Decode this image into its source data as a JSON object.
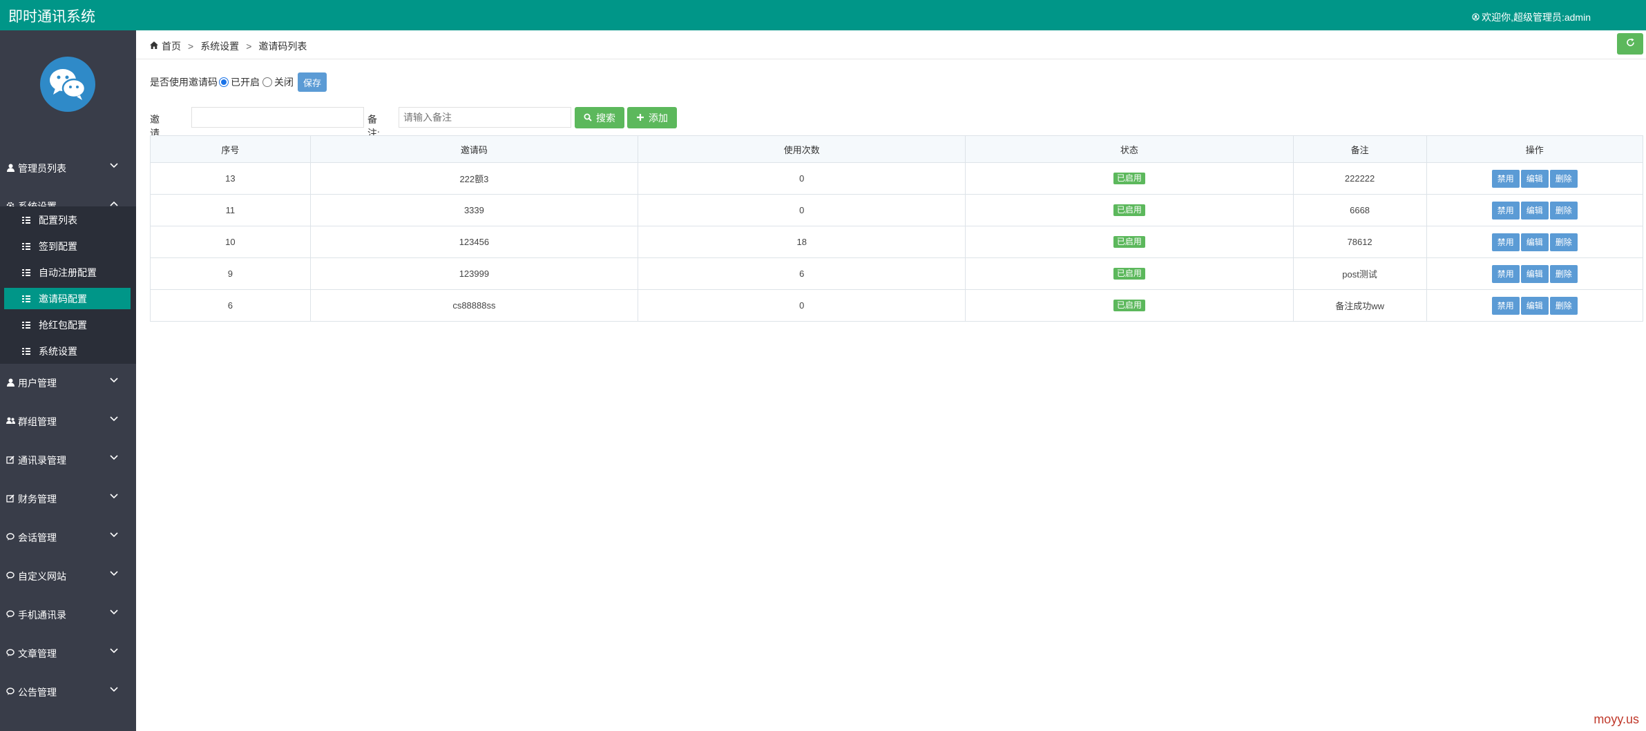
{
  "header": {
    "app_title": "即时通讯系统",
    "welcome": "欢迎你,超级管理员:admin",
    "user_icon": "user-circle-icon"
  },
  "sidebar": {
    "logo_icon": "wechat-logo-icon",
    "items": [
      {
        "label": "管理员列表",
        "icon": "user-icon"
      },
      {
        "label": "系统设置",
        "icon": "gear-icon"
      },
      {
        "label": "用户管理",
        "icon": "user-icon"
      },
      {
        "label": "群组管理",
        "icon": "users-icon"
      },
      {
        "label": "通讯录管理",
        "icon": "edit-icon"
      },
      {
        "label": "财务管理",
        "icon": "edit-icon"
      },
      {
        "label": "会话管理",
        "icon": "chat-icon"
      },
      {
        "label": "自定义网站",
        "icon": "chat-icon"
      },
      {
        "label": "手机通讯录",
        "icon": "chat-icon"
      },
      {
        "label": "文章管理",
        "icon": "chat-icon"
      },
      {
        "label": "公告管理",
        "icon": "chat-icon"
      }
    ],
    "sub_items": [
      {
        "label": "配置列表"
      },
      {
        "label": "签到配置"
      },
      {
        "label": "自动注册配置"
      },
      {
        "label": "邀请码配置"
      },
      {
        "label": "抢红包配置"
      },
      {
        "label": "系统设置"
      }
    ],
    "active_sub": "邀请码配置",
    "accent_color": "#009688"
  },
  "breadcrumb": {
    "home": "首页",
    "sep": ">",
    "level1": "系统设置",
    "level2": "邀请码列表"
  },
  "toggle": {
    "label": "是否使用邀请码",
    "on_label": "已开启",
    "off_label": "关闭",
    "selected": "已开启",
    "save_label": "保存"
  },
  "search": {
    "code_label": "邀请码:",
    "code_value": "",
    "remark_label": "备注:",
    "remark_placeholder": "请输入备注",
    "search_label": "搜索",
    "add_label": "添加"
  },
  "table": {
    "columns": [
      "序号",
      "邀请码",
      "使用次数",
      "状态",
      "备注",
      "操作"
    ],
    "rows": [
      {
        "id": "13",
        "code": "222额3",
        "uses": "0",
        "status": "已启用",
        "remark": "222222"
      },
      {
        "id": "11",
        "code": "3339",
        "uses": "0",
        "status": "已启用",
        "remark": "6668"
      },
      {
        "id": "10",
        "code": "123456",
        "uses": "18",
        "status": "已启用",
        "remark": "78612"
      },
      {
        "id": "9",
        "code": "123999",
        "uses": "6",
        "status": "已启用",
        "remark": "post测试"
      },
      {
        "id": "6",
        "code": "cs88888ss",
        "uses": "0",
        "status": "已启用",
        "remark": "备注成功ww"
      }
    ],
    "actions": {
      "disable": "禁用",
      "edit": "编辑",
      "delete": "删除"
    }
  },
  "watermark": "moyy.us"
}
